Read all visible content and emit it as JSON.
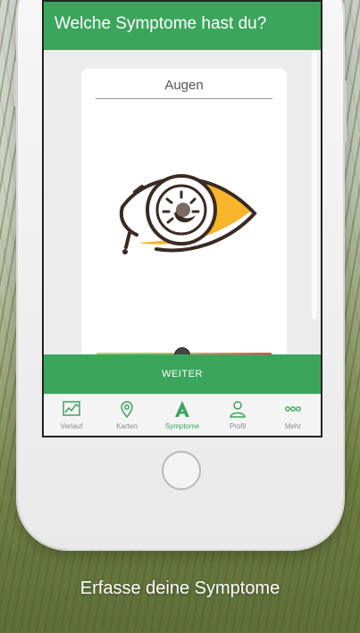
{
  "app": {
    "header_title": "Welche Symptome hast du?",
    "card_label": "Augen",
    "continue_label": "WEITER"
  },
  "tabs": [
    {
      "label": "Verlauf",
      "icon": "chart-icon",
      "active": false
    },
    {
      "label": "Karten",
      "icon": "map-pin-icon",
      "active": false
    },
    {
      "label": "Symptome",
      "icon": "symptom-a-icon",
      "active": true
    },
    {
      "label": "Profil",
      "icon": "profile-icon",
      "active": false
    },
    {
      "label": "Mehr",
      "icon": "more-dots-icon",
      "active": false
    }
  ],
  "slider": {
    "value_fraction": 0.49
  },
  "caption": "Erfasse deine Symptome",
  "colors": {
    "accent": "#3ba55c",
    "eye_fill": "#f6b52b",
    "slider_low": "#b6d36a",
    "slider_high": "#e8454f"
  }
}
